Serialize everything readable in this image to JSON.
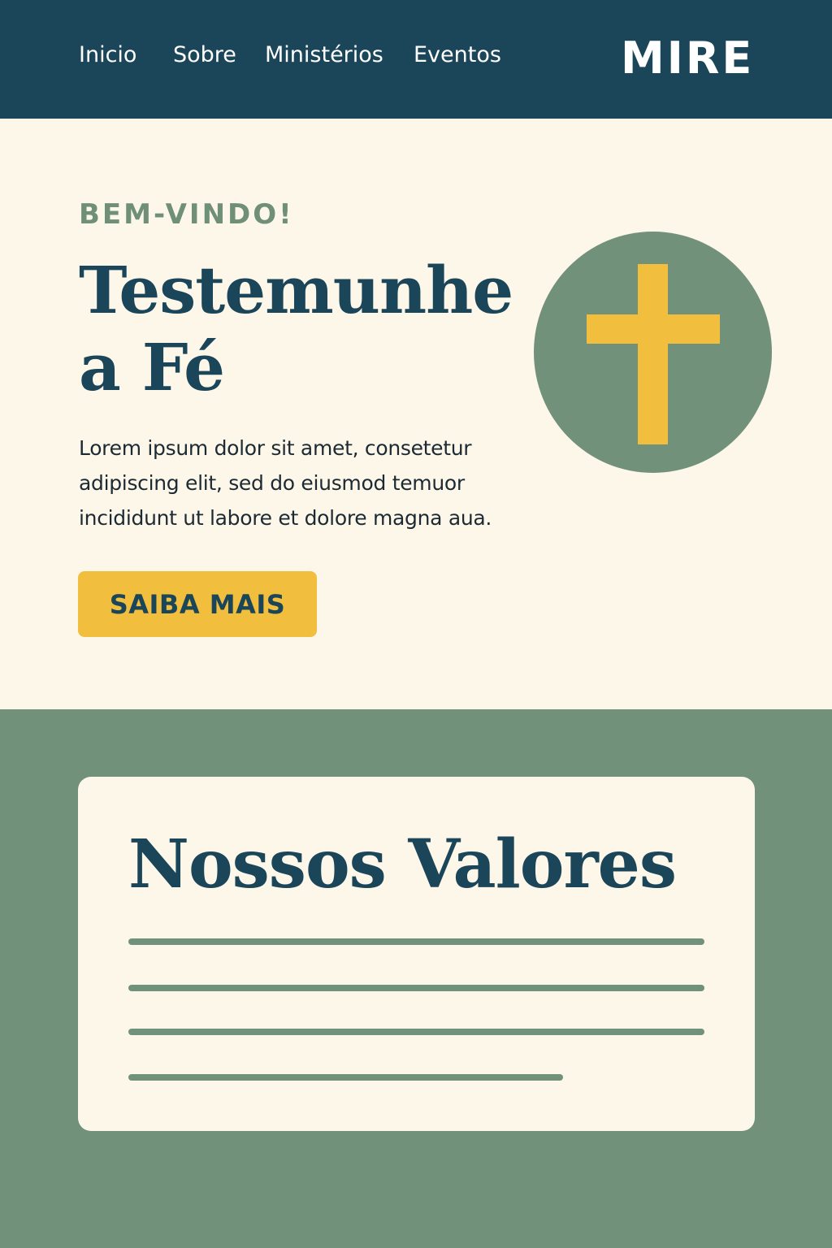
{
  "header": {
    "nav": [
      "Inicio",
      "Sobre",
      "Ministérios",
      "Eventos"
    ],
    "logo": "MIRE"
  },
  "hero": {
    "eyebrow": "BEM-VINDO!",
    "title_line1": "Testemunhe",
    "title_line2": "a Fé",
    "body": "Lorem ipsum dolor sit amet, consetetur adipiscing elit, sed do eiusmod temuor incididunt ut labore et dolore magna aua.",
    "cta_label": "SAIBA MAIS",
    "icon": "cross-icon"
  },
  "values": {
    "title": "Nossos Valores"
  },
  "colors": {
    "navy": "#1b4558",
    "cream": "#fdf7e9",
    "sage": "#71917a",
    "gold": "#f2be3e"
  }
}
